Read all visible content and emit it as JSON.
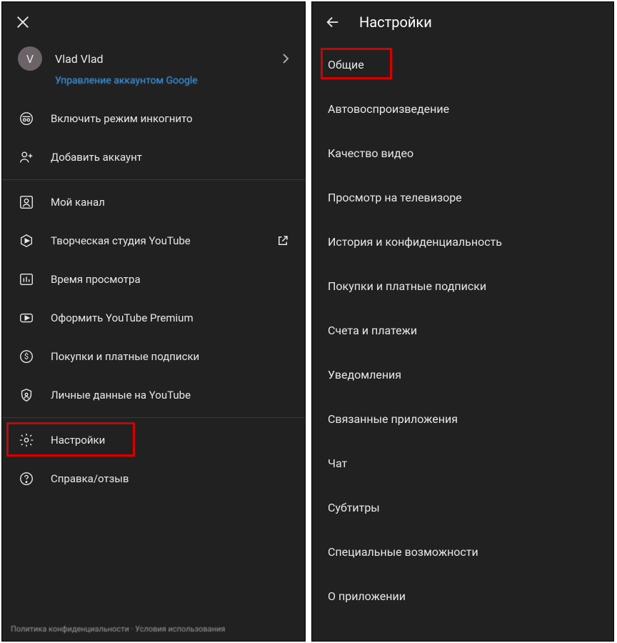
{
  "left": {
    "account": {
      "avatar_letter": "V",
      "name": "Vlad Vlad",
      "manage_link": "Управление аккаунтом Google"
    },
    "menu": [
      {
        "icon": "incognito-icon",
        "label": "Включить режим инкогнито"
      },
      {
        "icon": "add-account-icon",
        "label": "Добавить аккаунт"
      }
    ],
    "menu2": [
      {
        "icon": "channel-icon",
        "label": "Мой канал"
      },
      {
        "icon": "studio-icon",
        "label": "Творческая студия YouTube",
        "external": true
      },
      {
        "icon": "time-icon",
        "label": "Время просмотра"
      },
      {
        "icon": "premium-icon",
        "label": "Оформить YouTube Premium"
      },
      {
        "icon": "purchases-icon",
        "label": "Покупки и платные подписки"
      },
      {
        "icon": "privacy-icon",
        "label": "Личные данные на YouTube"
      }
    ],
    "menu3": [
      {
        "icon": "gear-icon",
        "label": "Настройки",
        "highlighted": true
      },
      {
        "icon": "help-icon",
        "label": "Справка/отзыв"
      }
    ],
    "footer": "Политика конфиденциальности  ·  Условия использования"
  },
  "right": {
    "title": "Настройки",
    "items": [
      {
        "label": "Общие",
        "highlighted": true
      },
      {
        "label": "Автовоспроизведение"
      },
      {
        "label": "Качество видео"
      },
      {
        "label": "Просмотр на телевизоре"
      },
      {
        "label": "История и конфиденциальность"
      },
      {
        "label": "Покупки и платные подписки"
      },
      {
        "label": "Счета и платежи"
      },
      {
        "label": "Уведомления"
      },
      {
        "label": "Связанные приложения"
      },
      {
        "label": "Чат"
      },
      {
        "label": "Субтитры"
      },
      {
        "label": "Специальные возможности"
      },
      {
        "label": "О приложении"
      }
    ]
  }
}
